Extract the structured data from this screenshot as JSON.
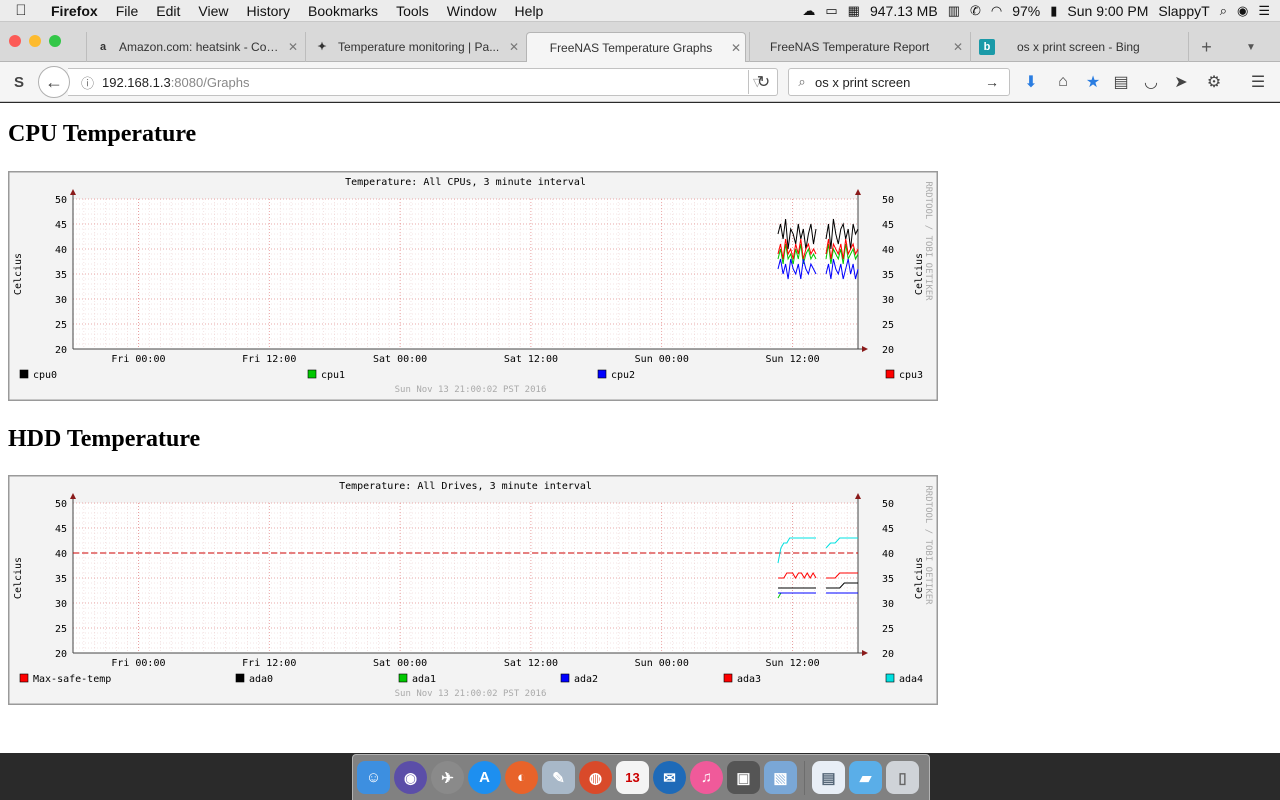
{
  "menubar": {
    "app": "Firefox",
    "items": [
      "File",
      "Edit",
      "View",
      "History",
      "Bookmarks",
      "Tools",
      "Window",
      "Help"
    ],
    "memory": "947.13 MB",
    "battery": "97%",
    "clock": "Sun 9:00 PM",
    "user": "SlappyT"
  },
  "tabs": [
    {
      "title": "Amazon.com: heatsink - Com...",
      "favicon": "a"
    },
    {
      "title": "Temperature monitoring | Pa...",
      "favicon": "✦"
    },
    {
      "title": "FreeNAS Temperature Graphs",
      "favicon": ""
    },
    {
      "title": "FreeNAS Temperature Report",
      "favicon": ""
    },
    {
      "title": "os x print screen - Bing",
      "favicon": "b"
    }
  ],
  "navbar": {
    "url_host": "192.168.1.3",
    "url_rest": ":8080/Graphs",
    "search_value": "os x print screen"
  },
  "cpu": {
    "heading": "CPU Temperature",
    "graph_title": "Temperature: All CPUs, 3 minute interval",
    "ylabel": "Celcius",
    "watermark": "RRDTOOL / TOBI OETIKER",
    "footer": "Sun Nov 13 21:00:02 PST 2016",
    "y_ticks": [
      "50",
      "45",
      "40",
      "35",
      "30",
      "25",
      "20"
    ],
    "x_ticks": [
      "Fri 00:00",
      "Fri 12:00",
      "Sat 00:00",
      "Sat 12:00",
      "Sun 00:00",
      "Sun 12:00"
    ],
    "legend": [
      {
        "label": "cpu0",
        "color": "#000000"
      },
      {
        "label": "cpu1",
        "color": "#00c800"
      },
      {
        "label": "cpu2",
        "color": "#0000ff"
      },
      {
        "label": "cpu3",
        "color": "#ff0000"
      }
    ]
  },
  "hdd": {
    "heading": "HDD Temperature",
    "graph_title": "Temperature: All Drives, 3 minute interval",
    "ylabel": "Celcius",
    "watermark": "RRDTOOL / TOBI OETIKER",
    "footer": "Sun Nov 13 21:00:02 PST 2016",
    "y_ticks": [
      "50",
      "45",
      "40",
      "35",
      "30",
      "25",
      "20"
    ],
    "x_ticks": [
      "Fri 00:00",
      "Fri 12:00",
      "Sat 00:00",
      "Sat 12:00",
      "Sun 00:00",
      "Sun 12:00"
    ],
    "legend": [
      {
        "label": "Max-safe-temp",
        "color": "#ff0000"
      },
      {
        "label": "ada0",
        "color": "#000000"
      },
      {
        "label": "ada1",
        "color": "#00c800"
      },
      {
        "label": "ada2",
        "color": "#0000ff"
      },
      {
        "label": "ada3",
        "color": "#ff0000"
      },
      {
        "label": "ada4",
        "color": "#00e0e0"
      }
    ]
  },
  "chart_data": [
    {
      "type": "line",
      "title": "Temperature: All CPUs, 3 minute interval",
      "ylabel": "Celcius",
      "ylim": [
        20,
        50
      ],
      "x_ticks": [
        "Fri 00:00",
        "Fri 12:00",
        "Sat 00:00",
        "Sat 12:00",
        "Sun 00:00",
        "Sun 12:00"
      ],
      "grid": true,
      "legend": "bottom",
      "series": [
        {
          "name": "cpu0",
          "color": "#000000",
          "segments": [
            [
              43,
              45,
              42,
              46,
              40,
              44,
              43,
              41,
              45,
              42,
              44,
              40,
              43,
              45,
              41,
              44
            ],
            [
              42,
              45,
              40,
              46,
              43,
              41,
              44,
              45,
              42,
              44,
              40,
              45,
              43,
              44
            ]
          ]
        },
        {
          "name": "cpu1",
          "color": "#00c800",
          "segments": [
            [
              38,
              40,
              37,
              41,
              38,
              39,
              37,
              40,
              38,
              41,
              37,
              39,
              40,
              38,
              39,
              38
            ],
            [
              38,
              41,
              37,
              40,
              39,
              38,
              40,
              37,
              41,
              38,
              39,
              40,
              38,
              39
            ]
          ]
        },
        {
          "name": "cpu2",
          "color": "#0000ff",
          "segments": [
            [
              36,
              38,
              35,
              37,
              34,
              38,
              36,
              35,
              37,
              34,
              38,
              36,
              35,
              37,
              36,
              35
            ],
            [
              35,
              37,
              34,
              38,
              36,
              35,
              37,
              34,
              36,
              38,
              35,
              37,
              34,
              36
            ]
          ]
        },
        {
          "name": "cpu3",
          "color": "#ff0000",
          "segments": [
            [
              39,
              41,
              38,
              42,
              39,
              40,
              38,
              41,
              39,
              42,
              38,
              40,
              41,
              39,
              40,
              39
            ],
            [
              39,
              42,
              38,
              41,
              40,
              39,
              41,
              38,
              42,
              39,
              40,
              41,
              39,
              40
            ]
          ]
        }
      ]
    },
    {
      "type": "line",
      "title": "Temperature: All Drives, 3 minute interval",
      "ylabel": "Celcius",
      "ylim": [
        20,
        50
      ],
      "x_ticks": [
        "Fri 00:00",
        "Fri 12:00",
        "Sat 00:00",
        "Sat 12:00",
        "Sun 00:00",
        "Sun 12:00"
      ],
      "grid": true,
      "legend": "bottom",
      "threshold": {
        "name": "Max-safe-temp",
        "value": 40,
        "color": "#cc0000"
      },
      "series": [
        {
          "name": "ada0",
          "color": "#000000",
          "segments": [
            [
              33,
              33,
              33,
              33,
              33,
              33,
              33,
              33,
              33,
              33,
              33,
              33,
              33,
              33
            ],
            [
              33,
              33,
              33,
              33,
              34,
              34,
              34,
              34
            ]
          ]
        },
        {
          "name": "ada1",
          "color": "#00c800",
          "segments": [
            [
              31,
              32,
              32,
              32,
              32,
              32,
              32,
              32,
              32,
              32,
              32,
              32,
              32,
              32
            ],
            [
              32,
              32,
              32,
              32,
              32,
              32,
              32,
              32
            ]
          ]
        },
        {
          "name": "ada2",
          "color": "#0000ff",
          "segments": [
            [
              32,
              32,
              32,
              32,
              32,
              32,
              32,
              32,
              32,
              32,
              32,
              32,
              32,
              32
            ],
            [
              32,
              32,
              32,
              32,
              32,
              32,
              32,
              32
            ]
          ]
        },
        {
          "name": "ada3",
          "color": "#ff0000",
          "segments": [
            [
              35,
              35,
              35,
              36,
              36,
              36,
              35,
              36,
              36,
              35,
              36,
              35,
              36,
              35
            ],
            [
              35,
              35,
              35,
              36,
              36,
              36,
              36,
              36
            ]
          ]
        },
        {
          "name": "ada4",
          "color": "#00e0e0",
          "segments": [
            [
              38,
              41,
              42,
              42,
              43,
              43,
              43,
              43,
              43,
              43,
              43,
              43,
              43,
              43
            ],
            [
              41,
              42,
              42,
              43,
              43,
              43,
              43,
              43
            ]
          ]
        }
      ]
    }
  ]
}
